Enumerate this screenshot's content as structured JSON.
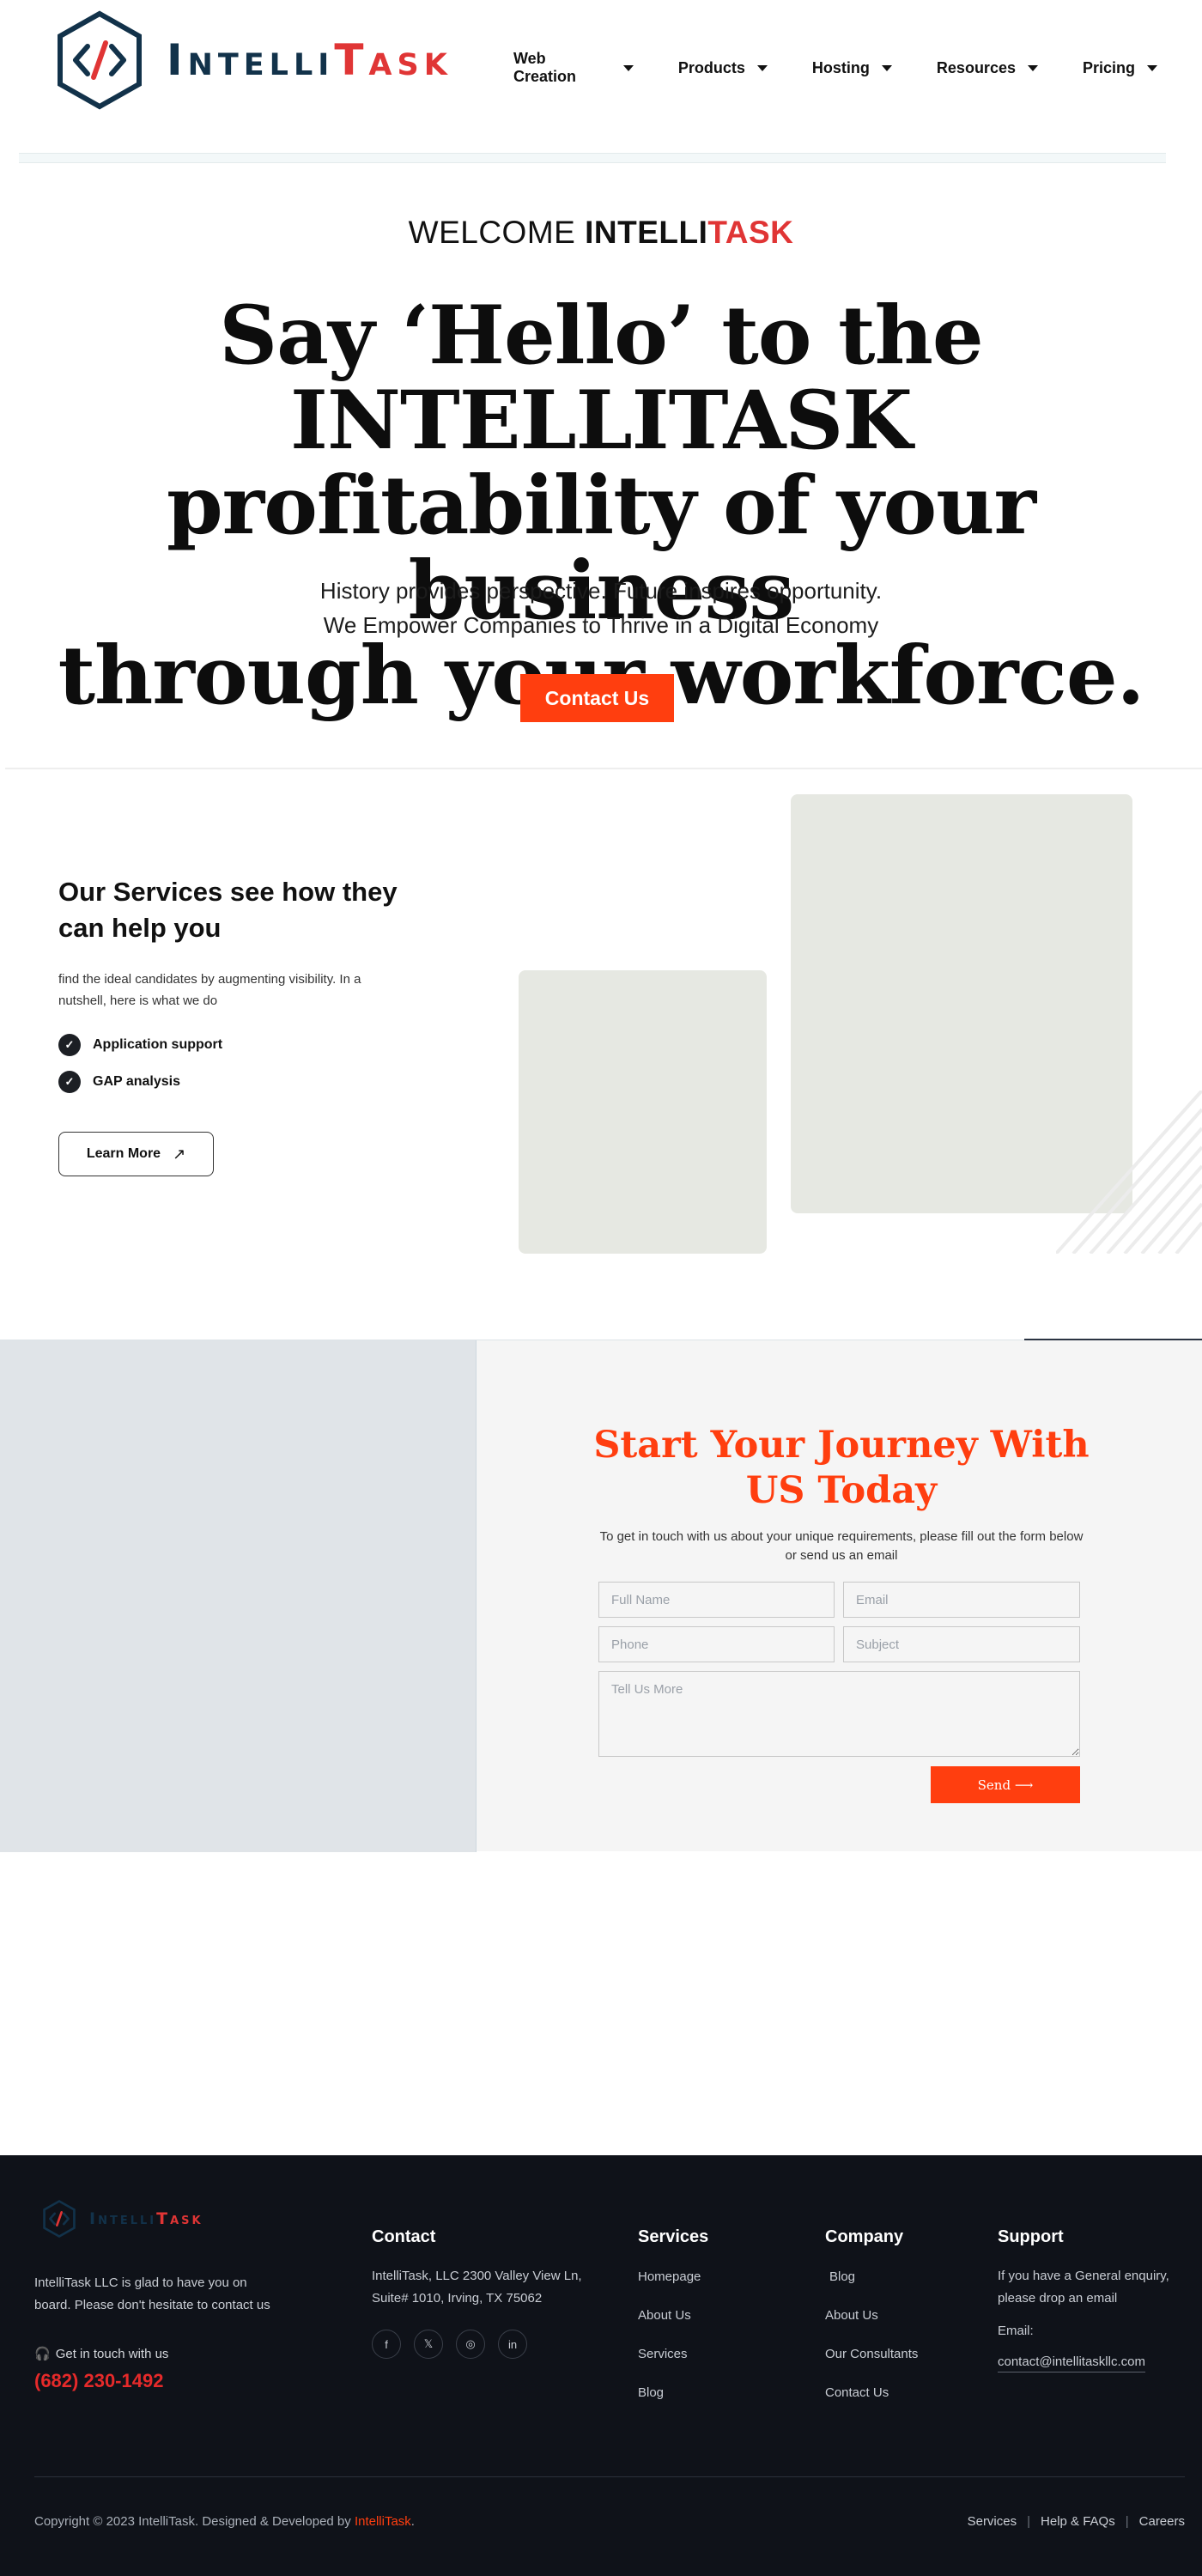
{
  "header": {
    "brand_part1": "Intelli",
    "brand_part2": "Task",
    "nav": [
      "Web Creation",
      "Products",
      "Hosting",
      "Resources",
      "Pricing"
    ]
  },
  "hero": {
    "welcome_prefix": "WELCOME ",
    "welcome_brand1": "INTELLI",
    "welcome_brand2": "TASK",
    "title_line1": "Say ‘Hello’ to the INTELLITASK",
    "title_line2": "profitability of your business",
    "title_line3": "through your workforce.",
    "sub_line1": "History provides perspective. Future inspires opportunity.",
    "sub_line2": "We Empower Companies to Thrive in a Digital Economy",
    "cta": "Contact Us"
  },
  "services": {
    "title": "Our Services see how they can help you",
    "description": "find the ideal candidates by augmenting visibility. In a nutshell, here is what we do",
    "items": [
      "Application support",
      "GAP analysis"
    ],
    "learn_more": "Learn More"
  },
  "journey": {
    "title": "Start Your Journey With US Today",
    "description": "To get in touch with us about your unique requirements, please fill out the form below or send us an email",
    "placeholders": {
      "full_name": "Full Name",
      "email": "Email",
      "phone": "Phone",
      "subject": "Subject",
      "message": "Tell Us More"
    },
    "send": "Send ⟶"
  },
  "footer": {
    "brand_part1": "Intelli",
    "brand_part2": "Task",
    "about": "IntelliTask LLC is glad to have you on board. Please don't hesitate to contact us",
    "get_in_touch": "Get in touch with us",
    "phone": "(682) 230-1492",
    "contact": {
      "title": "Contact",
      "address_line1": "IntelliTask, LLC 2300 Valley View Ln,",
      "address_line2": "Suite# 1010, Irving, TX 75062"
    },
    "services": {
      "title": "Services",
      "links": [
        "Homepage",
        "About Us",
        "Services",
        "Blog"
      ]
    },
    "company": {
      "title": "Company",
      "links": [
        "Blog",
        "About Us",
        "Our Consultants",
        "Contact Us"
      ]
    },
    "support": {
      "title": "Support",
      "text": "If you have a General enquiry, please drop an email",
      "email_label": "Email:",
      "email": "contact@intellitaskllc.com"
    },
    "copyright_prefix": "Copyright © 2023 IntelliTask. Designed & Developed by ",
    "copyright_brand": "IntelliTask",
    "copyright_suffix": ".",
    "bottom_links": [
      "Services",
      "Help & FAQs",
      "Careers"
    ]
  },
  "colors": {
    "accent": "#ff3e0f",
    "brand_navy": "#12324a",
    "brand_red": "#e03535",
    "footer_bg": "#0f1219"
  },
  "icons": [
    "code-hexagon-logo-icon",
    "chevron-down-icon",
    "check-icon",
    "arrow-up-right-icon",
    "headphones-icon",
    "facebook-icon",
    "x-twitter-icon",
    "dribbble-icon",
    "linkedin-icon"
  ]
}
